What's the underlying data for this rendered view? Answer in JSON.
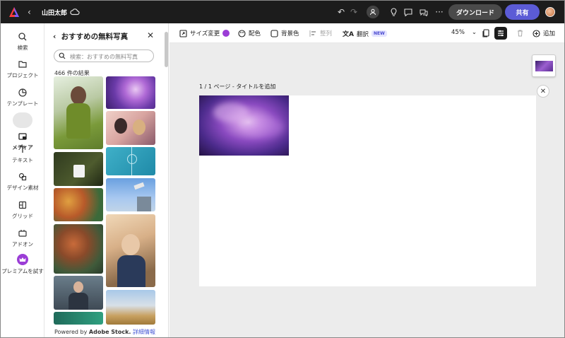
{
  "header": {
    "user_name": "山田太郎",
    "download_label": "ダウンロード",
    "share_label": "共有"
  },
  "rail": {
    "items": [
      {
        "label": "検索",
        "icon": "search-icon"
      },
      {
        "label": "プロジェクト",
        "icon": "folder-icon"
      },
      {
        "label": "テンプレート",
        "icon": "template-icon"
      },
      {
        "label": "メディア",
        "icon": "media-icon",
        "active": true
      },
      {
        "label": "テキスト",
        "icon": "text-icon"
      },
      {
        "label": "デザイン素材",
        "icon": "shapes-icon"
      },
      {
        "label": "グリッド",
        "icon": "grid-icon"
      },
      {
        "label": "アドオン",
        "icon": "addon-icon"
      },
      {
        "label": "プレミアムを試す",
        "icon": "crown-icon"
      }
    ]
  },
  "panel": {
    "title": "おすすめの無料写真",
    "search_placeholder": "検索：おすすめの無料写真",
    "result_count": "466 件の結果",
    "footer_text": "Powered by ",
    "footer_brand": "Adobe Stock.",
    "footer_link": "詳細情報"
  },
  "toolbar": {
    "resize_label": "サイズ変更",
    "color_label": "配色",
    "bg_label": "背景色",
    "arrange_label": "整列",
    "translate_label": "翻訳",
    "new_badge": "NEW",
    "zoom": "45%",
    "add_label": "追加"
  },
  "canvas": {
    "page_label": "1 / 1 ページ - タイトルを追加"
  },
  "colors": {
    "accent": "#5b5bd6",
    "topbar": "#1c1c1c",
    "canvas_bg": "#ececec"
  }
}
